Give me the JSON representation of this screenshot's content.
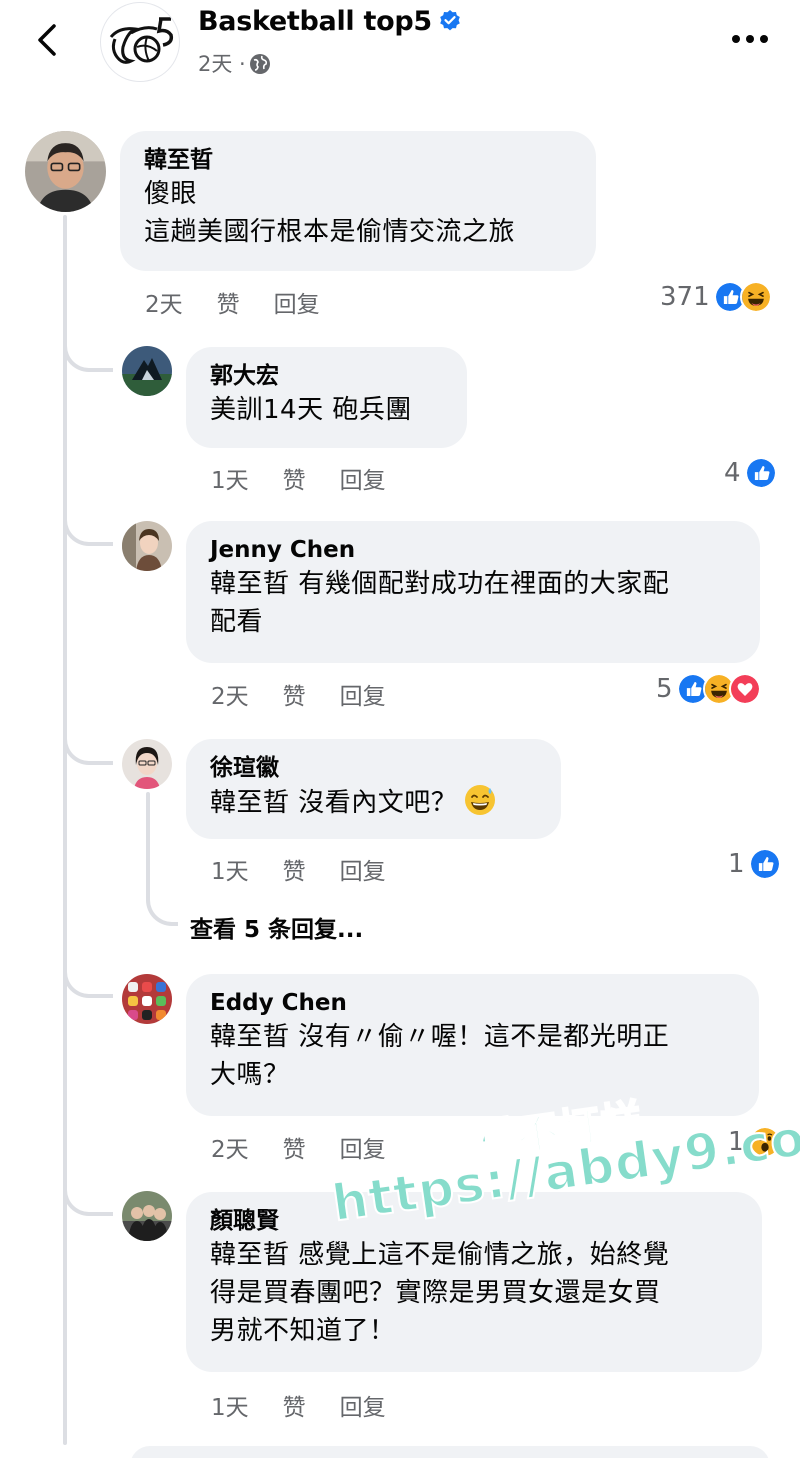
{
  "header": {
    "page_name": "Basketball top5",
    "meta_time": "2天 ·"
  },
  "comments": [
    {
      "author": "韓至晢",
      "lines": [
        "傻眼",
        "這趟美國行根本是偷情交流之旅"
      ],
      "time": "2天",
      "like": "赞",
      "reply": "回复",
      "reaction_count": "371",
      "reaction_icons": [
        "like-icon",
        "haha-icon"
      ]
    },
    {
      "author": "郭大宏",
      "lines": [
        "美訓14天 砲兵團"
      ],
      "time": "1天",
      "like": "赞",
      "reply": "回复",
      "reaction_count": "4",
      "reaction_icons": [
        "like-icon"
      ]
    },
    {
      "author": "Jenny Chen",
      "lines": [
        "韓至晢 有幾個配對成功在裡面的大家配",
        "配看"
      ],
      "time": "2天",
      "like": "赞",
      "reply": "回复",
      "reaction_count": "5",
      "reaction_icons": [
        "like-icon",
        "haha-icon",
        "love-icon"
      ]
    },
    {
      "author": "徐瑄徽",
      "lines": [
        "韓至晢 沒看內文吧？"
      ],
      "time": "1天",
      "like": "赞",
      "reply": "回复",
      "reaction_count": "1",
      "reaction_icons": [
        "like-icon"
      ]
    },
    {
      "author": "Eddy Chen",
      "lines": [
        "韓至晢 沒有〃偷〃喔！這不是都光明正",
        "大嗎？"
      ],
      "time": "2天",
      "like": "赞",
      "reply": "回复",
      "reaction_count": "1",
      "reaction_icons": [
        "wow-icon"
      ]
    },
    {
      "author": "顏聰賢",
      "lines": [
        "韓至晢 感覺上這不是偷情之旅，始終覺",
        "得是買春團吧？實際是男買女還是女買",
        "男就不知道了！"
      ],
      "time": "1天",
      "like": "赞",
      "reply": "回复"
    }
  ],
  "view_replies": "查看 5 条回复...",
  "watermark": {
    "line1": "黑料不打烊",
    "line2": "https://abdy9.com"
  },
  "colors": {
    "like_blue": "#1877f2",
    "bubble_bg": "#f0f2f5",
    "meta_gray": "#65676b",
    "watermark": "#7fd8c8"
  }
}
